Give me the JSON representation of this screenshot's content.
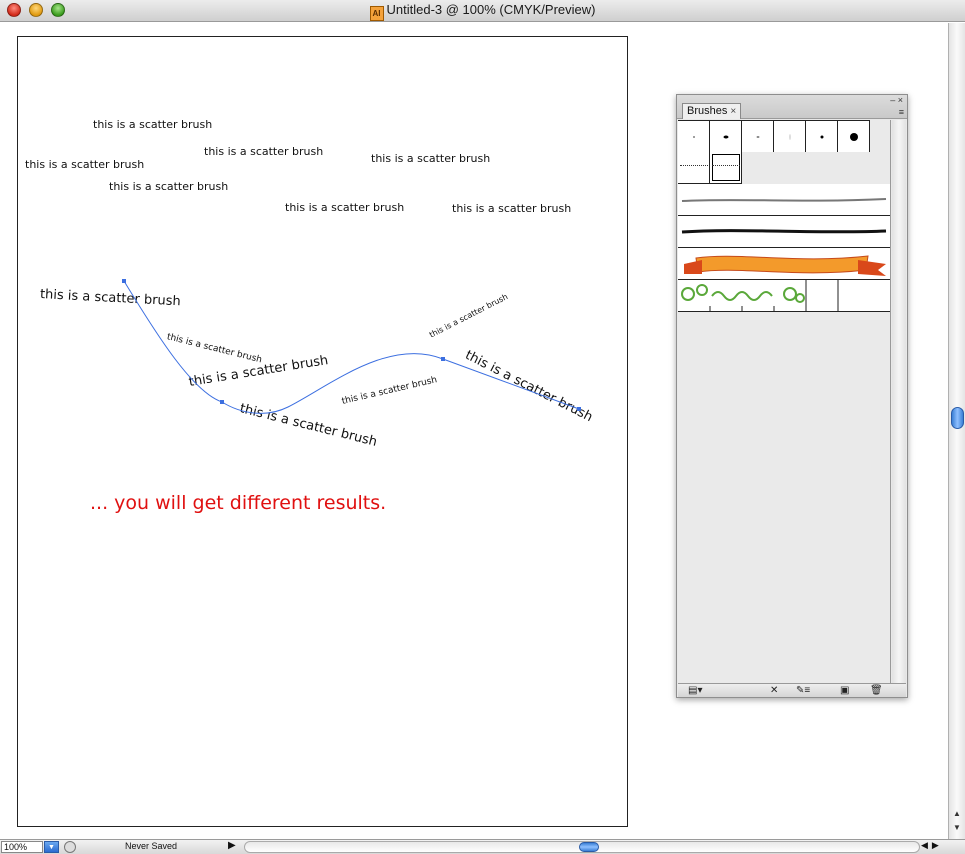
{
  "window": {
    "title": "Untitled-3 @ 100% (CMYK/Preview)",
    "app_icon": "AI"
  },
  "artboard": {
    "scatter_label": "this is a scatter brush",
    "caption": "... you will get different results."
  },
  "statusbar": {
    "zoom": "100%",
    "status": "Never Saved"
  },
  "brushes_panel": {
    "tab_label": "Brushes",
    "tab_close": "×",
    "controls": "– ×",
    "menu_icon": "≡"
  },
  "colors": {
    "caption_red": "#e01010",
    "path_blue": "#3c6fe0",
    "ribbon_orange": "#f39a2b",
    "vine_green": "#5aa83a"
  },
  "icons": [
    "close-icon",
    "minimize-icon",
    "zoom-icon",
    "ai-document-icon",
    "zoom-dropdown-icon",
    "status-icon",
    "new-brush-library-icon",
    "remove-brush-stroke-icon",
    "options-icon",
    "new-brush-icon",
    "trash-icon"
  ]
}
